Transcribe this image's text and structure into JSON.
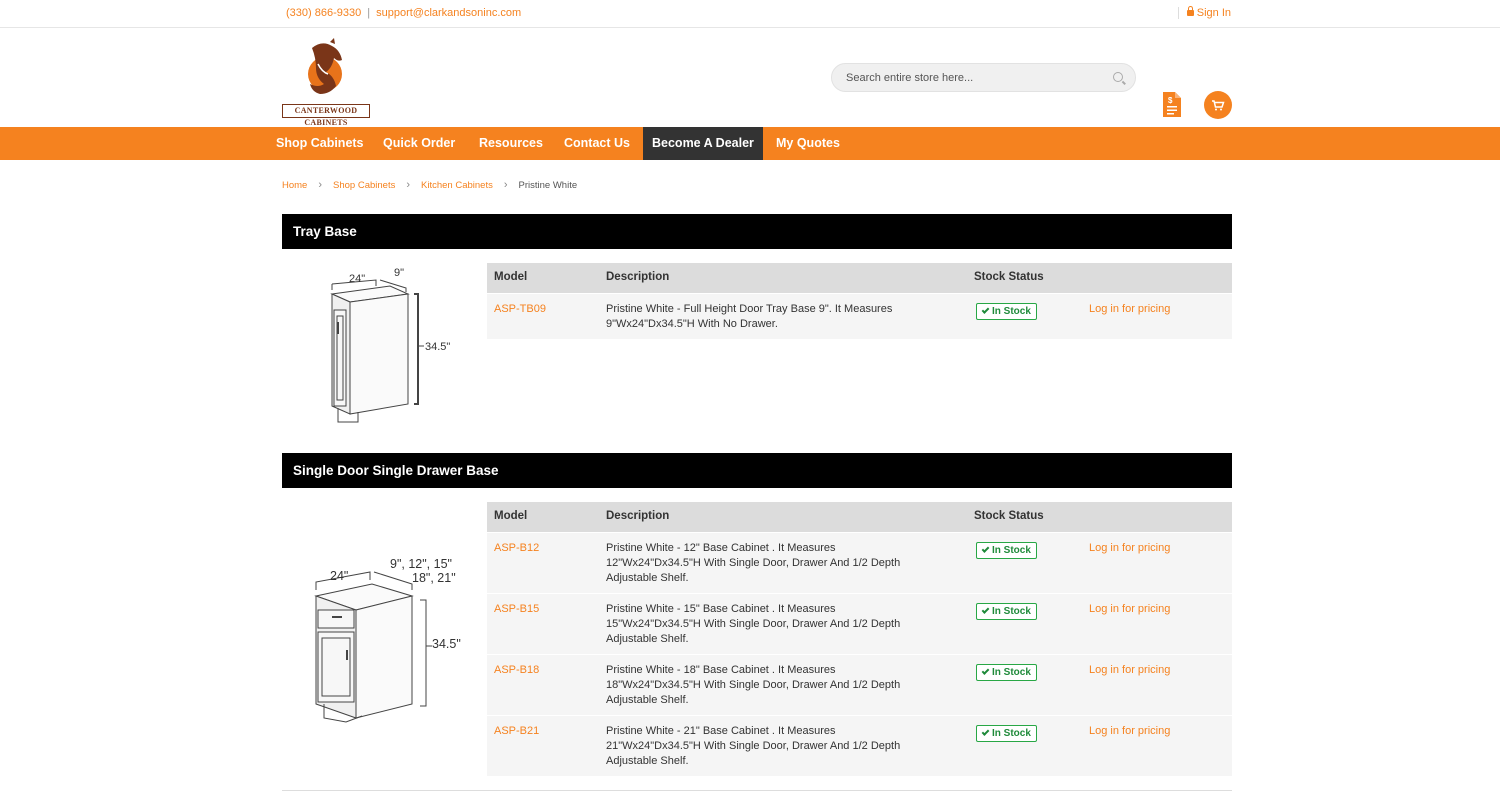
{
  "topbar": {
    "phone": "(330) 866-9330",
    "separator": "|",
    "email": "support@clarkandsoninc.com",
    "signin": "Sign In"
  },
  "header": {
    "logo_text": "CANTERWOOD CABINETS",
    "search_placeholder": "Search entire store here..."
  },
  "nav": {
    "items": [
      {
        "label": "Shop Cabinets"
      },
      {
        "label": "Quick Order"
      },
      {
        "label": "Resources"
      },
      {
        "label": "Contact Us"
      },
      {
        "label": "Become A Dealer",
        "active": true
      },
      {
        "label": "My Quotes"
      }
    ]
  },
  "breadcrumb": {
    "items": [
      "Home",
      "Shop Cabinets",
      "Kitchen Cabinets"
    ],
    "current": "Pristine White"
  },
  "table_headers": {
    "model": "Model",
    "description": "Description",
    "stock": "Stock Status"
  },
  "sections": [
    {
      "title": "Tray Base",
      "dims": {
        "width": "24\"",
        "depth": "9\"",
        "height": "34.5\""
      },
      "rows": [
        {
          "model": "ASP-TB09",
          "description": "Pristine White - Full Height Door Tray Base 9\". It Measures 9\"Wx24\"Dx34.5\"H With No Drawer.",
          "stock": "In Stock",
          "price": "Log in for pricing"
        }
      ]
    },
    {
      "title": "Single Door Single Drawer Base",
      "dims": {
        "width": "24\"",
        "depth_line1": "9\", 12\", 15\"",
        "depth_line2": "18\", 21\"",
        "height": "34.5\""
      },
      "rows": [
        {
          "model": "ASP-B12",
          "description": "Pristine White - 12\" Base Cabinet . It Measures 12\"Wx24\"Dx34.5\"H With Single Door, Drawer And 1/2 Depth Adjustable Shelf.",
          "stock": "In Stock",
          "price": "Log in for pricing"
        },
        {
          "model": "ASP-B15",
          "description": "Pristine White - 15\" Base Cabinet . It Measures 15\"Wx24\"Dx34.5\"H With Single Door, Drawer And 1/2 Depth Adjustable Shelf.",
          "stock": "In Stock",
          "price": "Log in for pricing"
        },
        {
          "model": "ASP-B18",
          "description": "Pristine White - 18\" Base Cabinet . It Measures 18\"Wx24\"Dx34.5\"H With Single Door, Drawer And 1/2 Depth Adjustable Shelf.",
          "stock": "In Stock",
          "price": "Log in for pricing"
        },
        {
          "model": "ASP-B21",
          "description": "Pristine White - 21\" Base Cabinet . It Measures 21\"Wx24\"Dx34.5\"H With Single Door, Drawer And 1/2 Depth Adjustable Shelf.",
          "stock": "In Stock",
          "price": "Log in for pricing"
        }
      ]
    }
  ],
  "colors": {
    "accent": "#f5821f",
    "nav_active": "#333333",
    "section_bar": "#000000",
    "in_stock": "#1f8a3a"
  },
  "icons": [
    "lock-icon",
    "search-icon",
    "quote-document-icon",
    "cart-icon",
    "chevron-right-icon",
    "check-icon",
    "horse-logo"
  ]
}
